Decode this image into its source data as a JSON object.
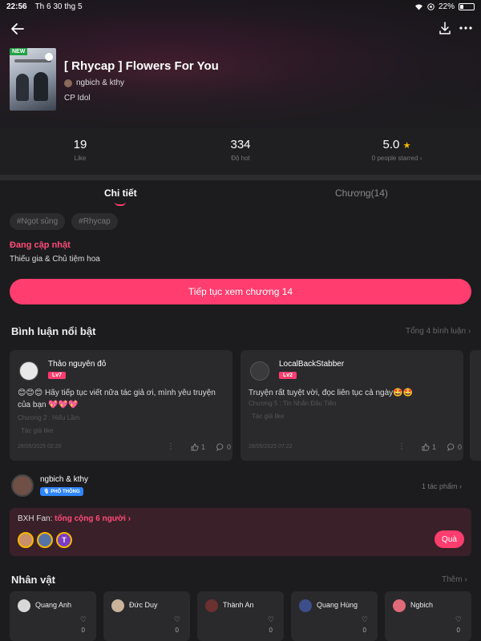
{
  "status_bar": {
    "time": "22:56",
    "date": "Th 6 30 thg 5",
    "battery": "22%",
    "battery_level": 0.22
  },
  "header": {
    "icons": [
      "back-arrow-icon",
      "download-icon",
      "more-icon"
    ]
  },
  "book": {
    "badge": "NEW",
    "title": "[ Rhycap ] Flowers For You",
    "author": "ngbich & kthy",
    "genre": "CP Idol"
  },
  "stats": {
    "likes": "19",
    "likes_label": "Like",
    "hot": "334",
    "hot_label": "Độ hot",
    "rating": "5.0",
    "rating_label": "0 people starred",
    "rating_color": "#f5b800"
  },
  "tabs": {
    "detail": "Chi tiết",
    "chapters": "Chương(14)"
  },
  "tags": [
    "#Ngọt sủng",
    "#Rhycap"
  ],
  "update": {
    "label": "Đang cập nhật",
    "description": "Thiếu gia & Chủ tiệm hoa"
  },
  "continue_button": "Tiếp tục xem chương 14",
  "accent_color": "#ff3d6e",
  "comments_section": {
    "title": "Bình luận nổi bật",
    "total_link": "Tổng 4 bình luận",
    "comments": [
      {
        "name": "Thảo nguyên đỏ",
        "level": "Lv7",
        "text": "😊😊😊 Hãy tiếp tục viết nữa tác giả ơi, mình yêu truyện của bạn 💖💖💖",
        "chapter": "Chương 2 : Hiểu Lầm",
        "author_liked": "Tác giả like",
        "date": "28/05/2025 02:20",
        "likes": "1",
        "replies": "0"
      },
      {
        "name": "LocalBackStabber",
        "level": "Lv2",
        "text": "Truyện rất tuyệt vời, đọc liên tục cả ngày🤩🤩",
        "chapter": "Chương 5 : Tin Nhắn Đầu Tiên",
        "author_liked": "Tác giả like",
        "date": "28/05/2025 07:22",
        "likes": "1",
        "replies": "0"
      }
    ]
  },
  "author_block": {
    "name": "ngbich & kthy",
    "badge": "PHỔ THÔNG",
    "works": "1 tác phẩm"
  },
  "fan_ranking": {
    "prefix": "BXH Fan:",
    "total": "tổng cộng 6 người",
    "third_initial": "T",
    "gift_button": "Quà"
  },
  "characters_section": {
    "title": "Nhân vật",
    "more_link": "Thêm",
    "characters": [
      {
        "name": "Quang Anh",
        "likes": "0"
      },
      {
        "name": "Đức Duy",
        "likes": "0"
      },
      {
        "name": "Thành An",
        "likes": "0"
      },
      {
        "name": "Quang Hùng",
        "likes": "0"
      },
      {
        "name": "Ngbich",
        "likes": "0"
      }
    ]
  }
}
